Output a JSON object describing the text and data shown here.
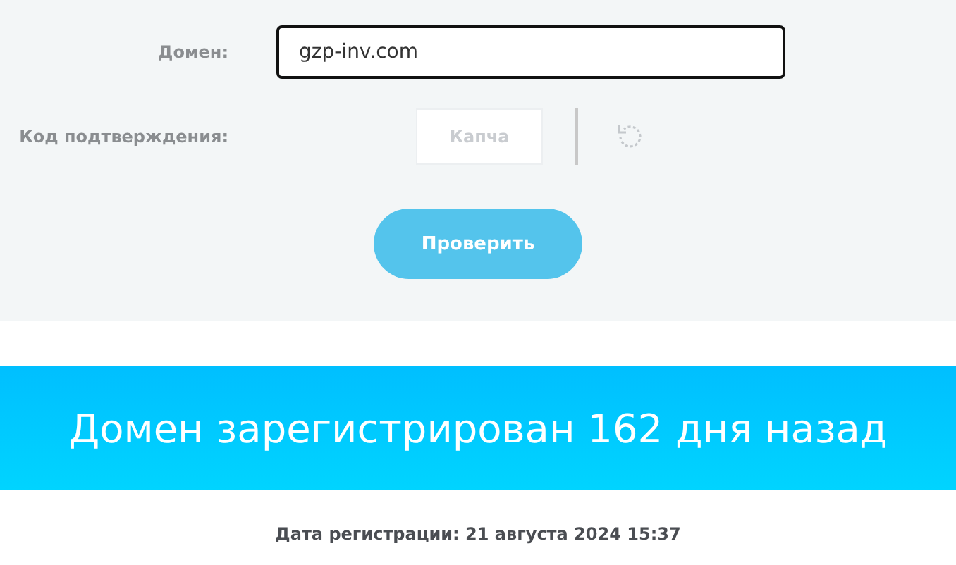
{
  "form": {
    "domain": {
      "label": "Домен:",
      "value": "gzp-inv.com"
    },
    "captcha": {
      "label": "Код подтверждения:",
      "placeholder": "Капча"
    },
    "submit": "Проверить"
  },
  "result": {
    "banner": "Домен зарегистрирован 162 дня назад",
    "registration": "Дата регистрации: 21 августа 2024 15:37"
  }
}
